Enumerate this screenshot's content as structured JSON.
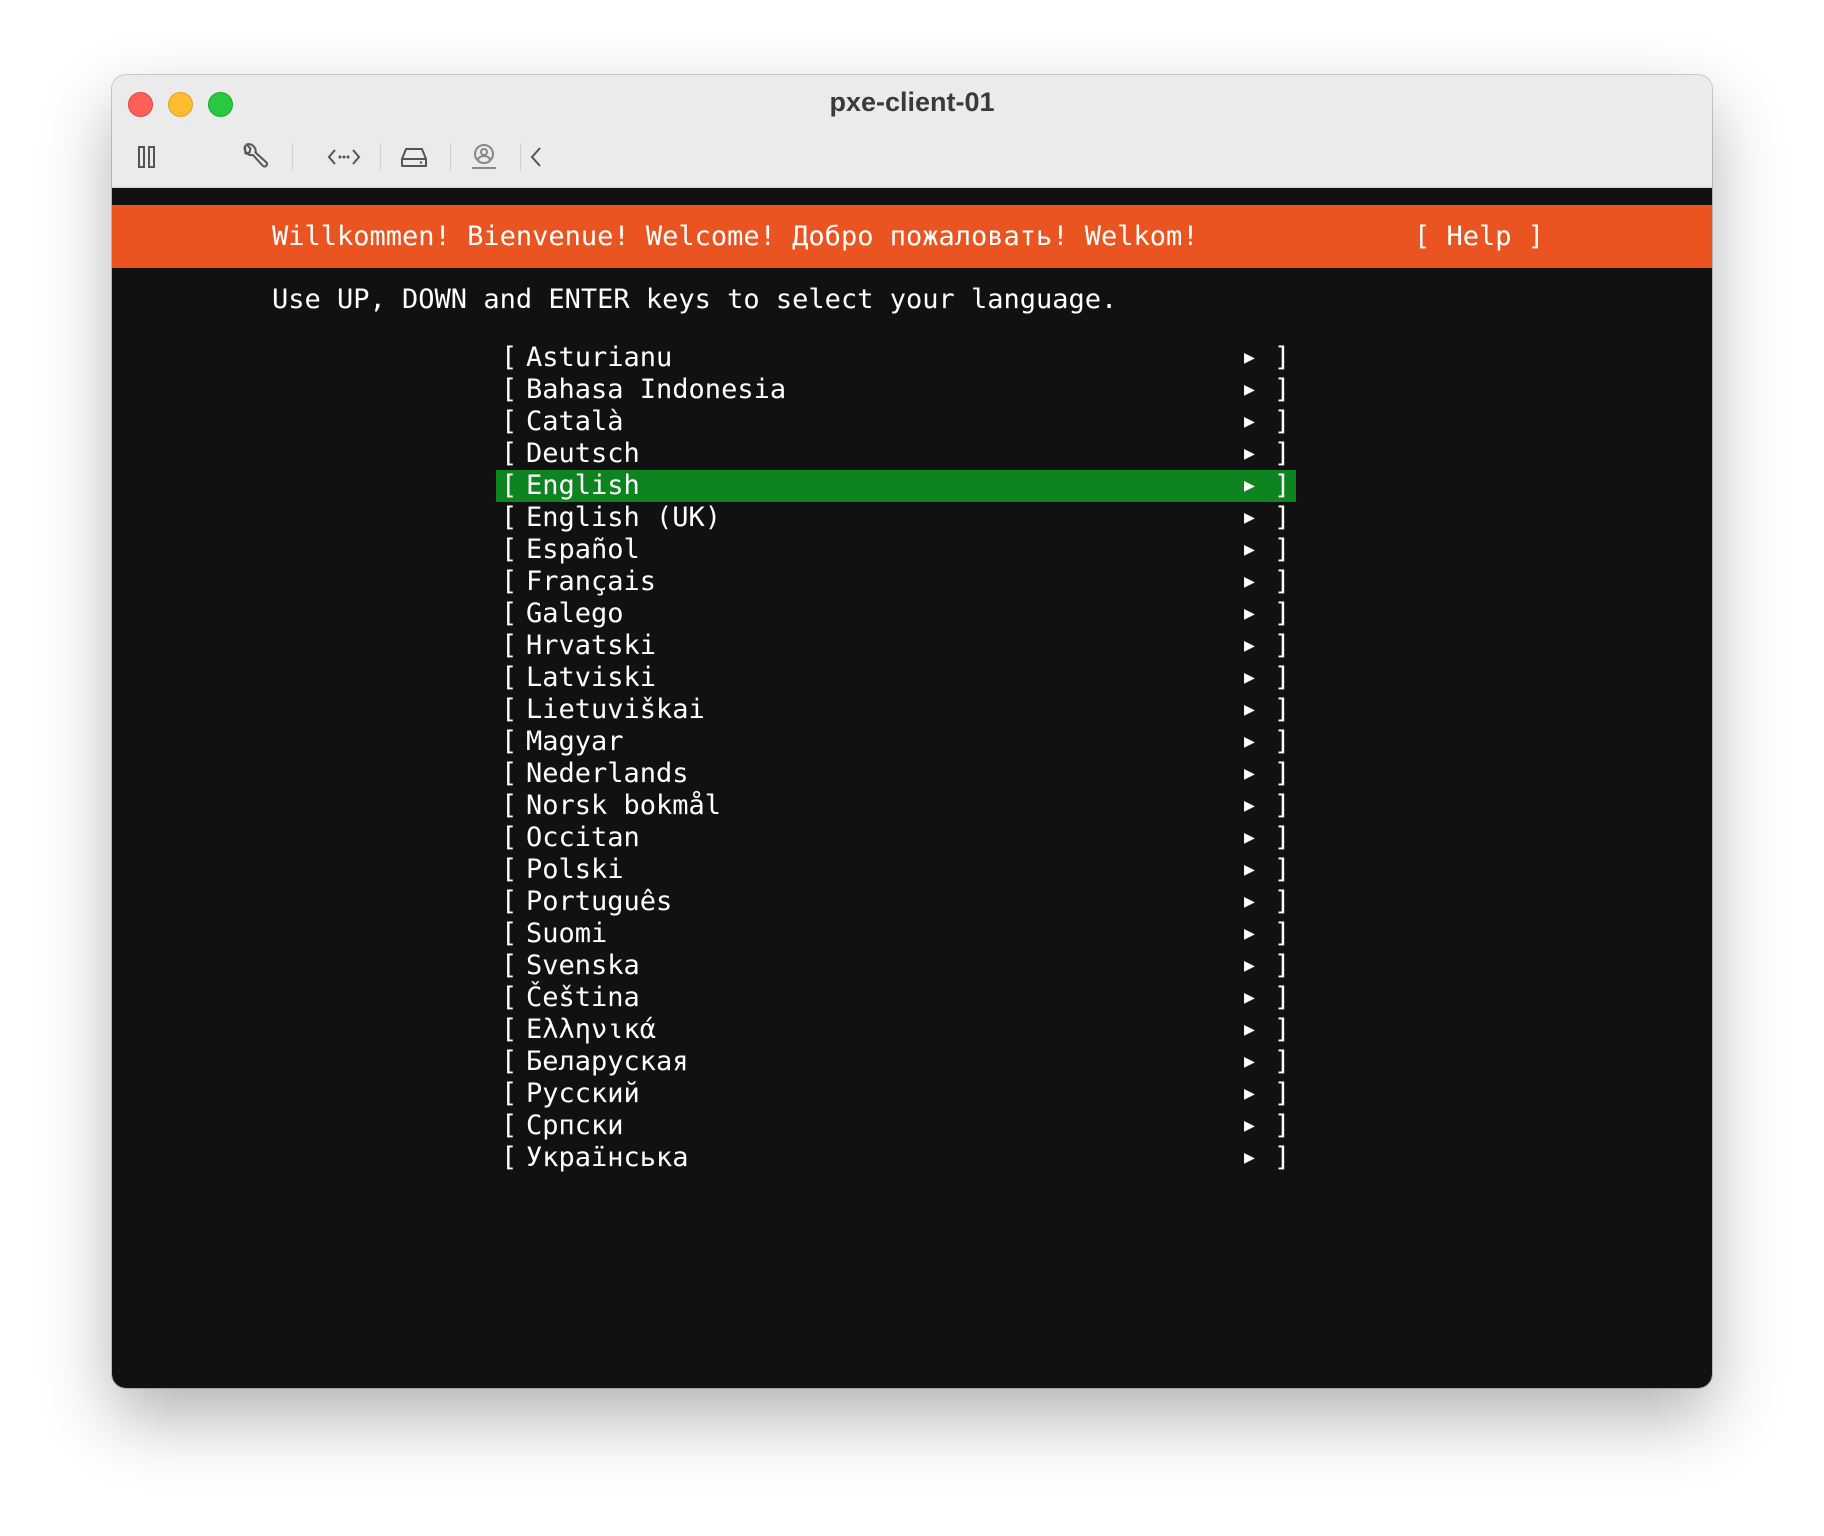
{
  "window": {
    "title": "pxe-client-01"
  },
  "toolbar": {
    "icons": [
      "pause-icon",
      "wrench-icon",
      "code-arrows-icon",
      "disk-icon",
      "user-icon",
      "chevron-left-icon"
    ]
  },
  "installer": {
    "banner": "Willkommen! Bienvenue! Welcome! Добро пожаловать! Welkom!",
    "help": "[ Help ]",
    "instruction": "Use UP, DOWN and ENTER keys to select your language.",
    "bracket_open": "[",
    "bracket_close": "]",
    "arrow": "▶",
    "selected_index": 4,
    "colors": {
      "banner": "#e95420",
      "selected": "#0e8420",
      "background": "#111111"
    },
    "languages": [
      "Asturianu",
      "Bahasa Indonesia",
      "Català",
      "Deutsch",
      "English",
      "English (UK)",
      "Español",
      "Français",
      "Galego",
      "Hrvatski",
      "Latviski",
      "Lietuviškai",
      "Magyar",
      "Nederlands",
      "Norsk bokmål",
      "Occitan",
      "Polski",
      "Português",
      "Suomi",
      "Svenska",
      "Čeština",
      "Ελληνικά",
      "Беларуская",
      "Русский",
      "Српски",
      "Українська"
    ]
  }
}
